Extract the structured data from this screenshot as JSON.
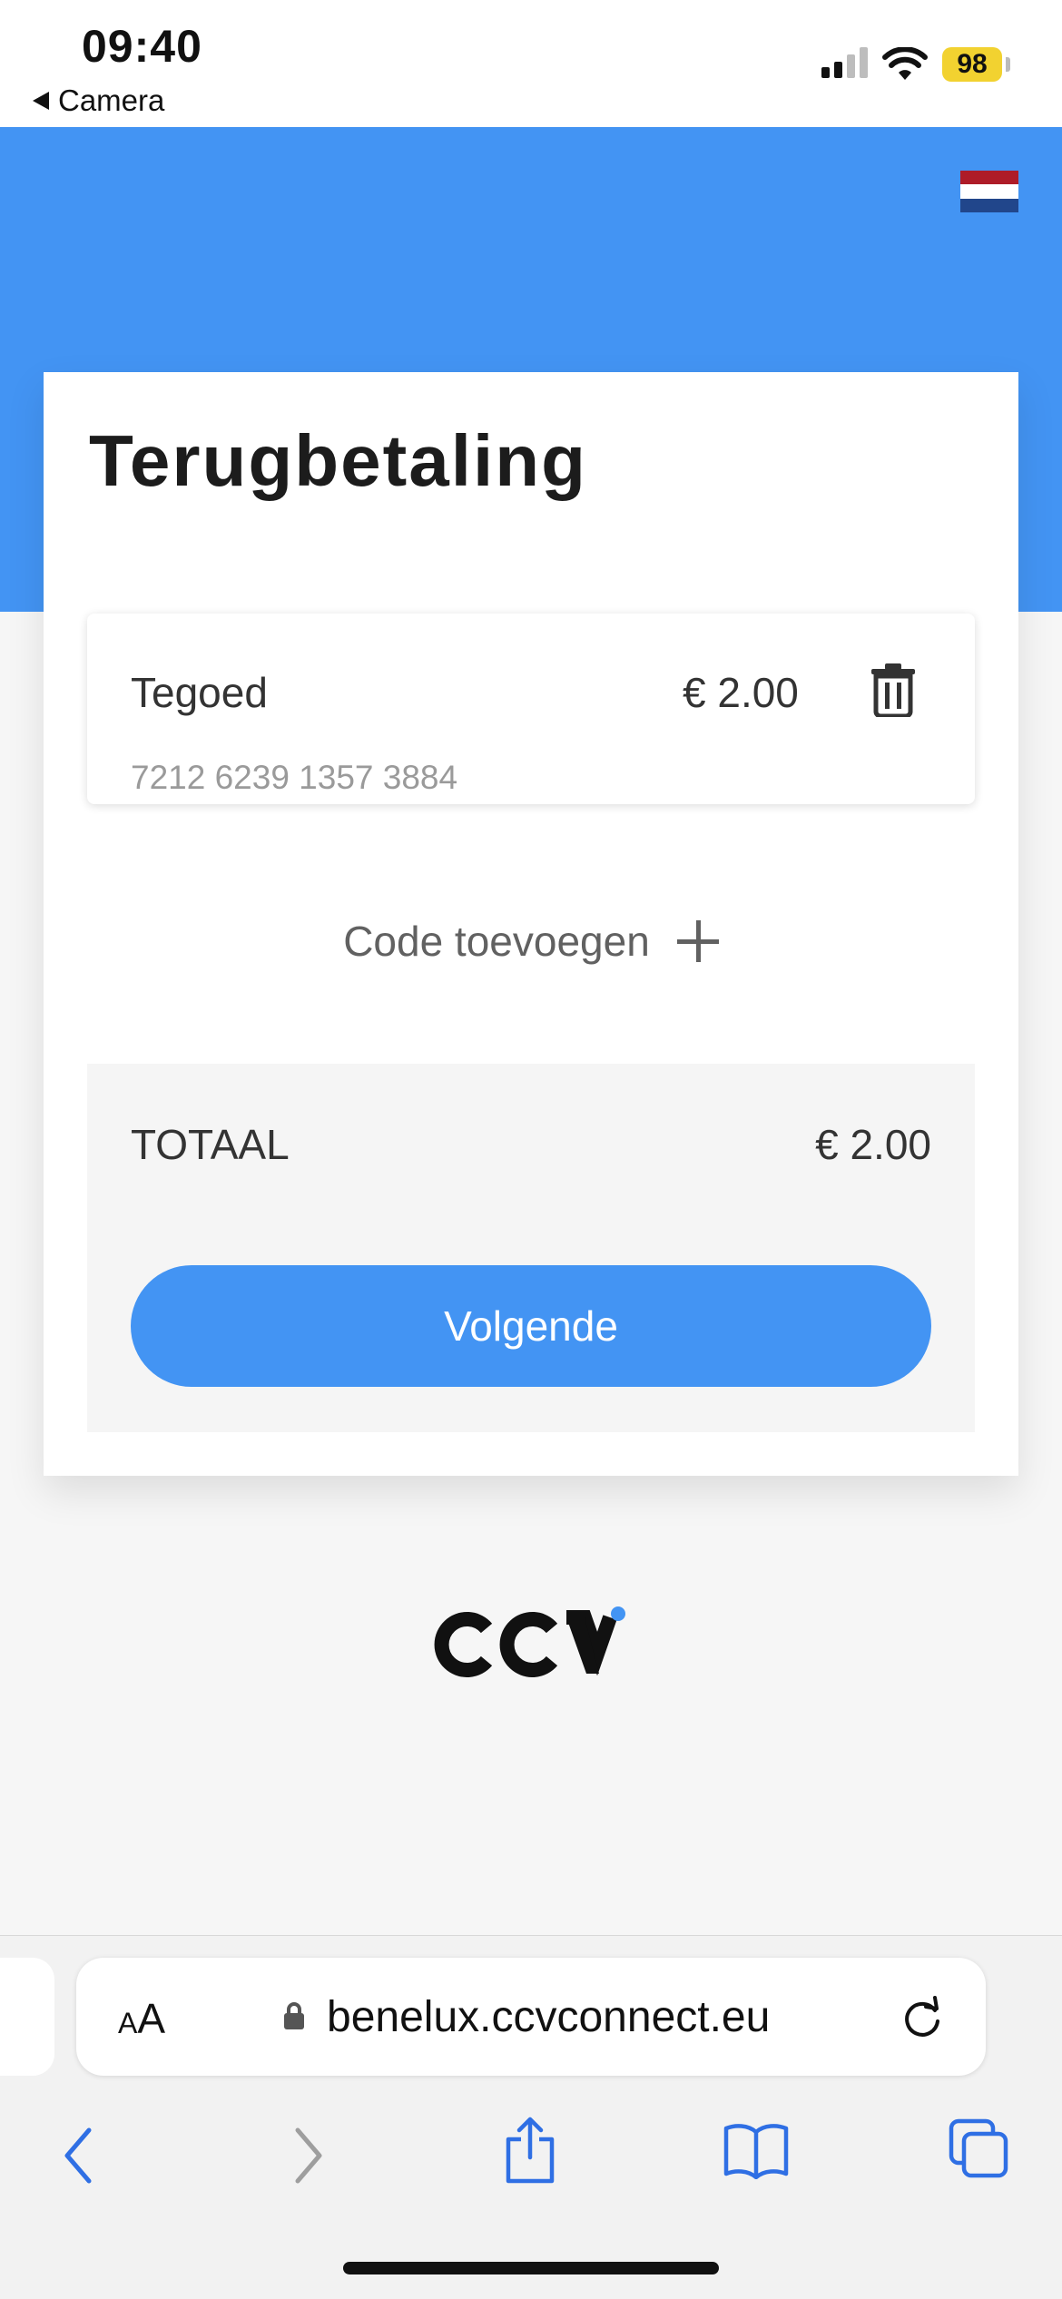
{
  "status_bar": {
    "time": "09:40",
    "back_app": "Camera",
    "battery": "98",
    "icons": [
      "signal-icon",
      "wifi-icon",
      "battery-icon"
    ]
  },
  "header": {
    "language_flag": "dutch-flag-icon",
    "flag_colors": [
      "#ae1c28",
      "#ffffff",
      "#21468b"
    ],
    "accent_color": "#4394f3"
  },
  "card": {
    "title": "Terugbetaling",
    "items": [
      {
        "label": "Tegoed",
        "amount": "€ 2.00",
        "code": "7212 6239 1357 3884"
      }
    ],
    "add_code_label": "Code toevoegen",
    "total_label": "TOTAAL",
    "total_amount": "€ 2.00",
    "next_button": "Volgende"
  },
  "footer": {
    "logo": "ccv-logo"
  },
  "browser": {
    "text_size_label_small": "A",
    "text_size_label_large": "A",
    "url": "benelux.ccvconnect.eu",
    "nav": [
      "back-icon",
      "forward-icon",
      "share-icon",
      "bookmarks-icon",
      "tabs-icon"
    ]
  }
}
